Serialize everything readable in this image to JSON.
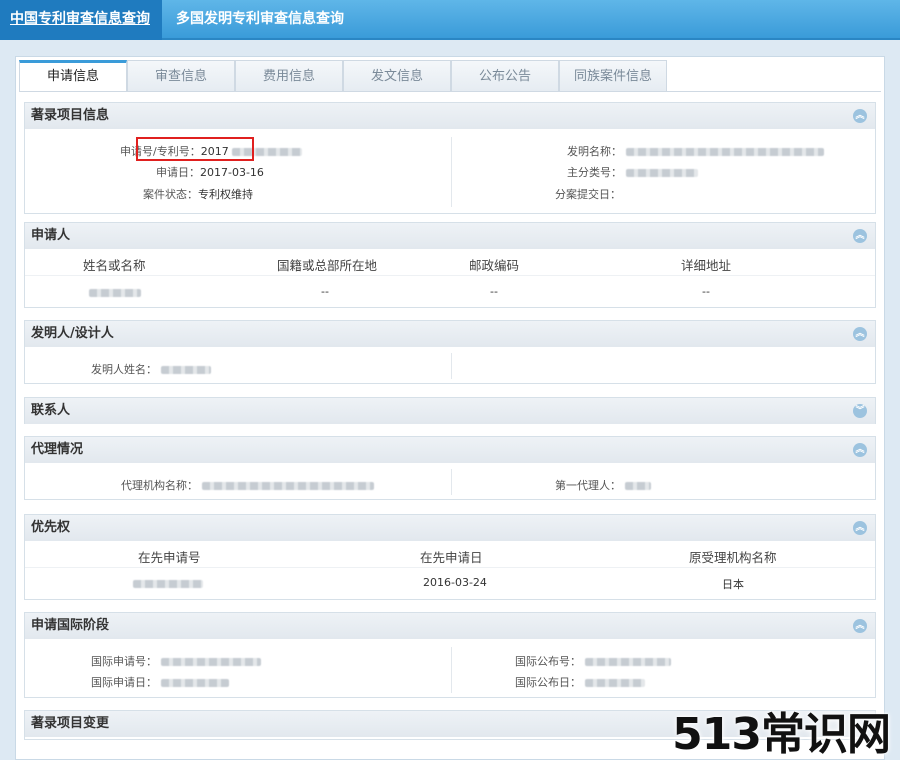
{
  "topnav": {
    "tabs": [
      "中国专利审查信息查询",
      "多国发明专利审查信息查询"
    ]
  },
  "tabs": [
    "申请信息",
    "审查信息",
    "费用信息",
    "发文信息",
    "公布公告",
    "同族案件信息"
  ],
  "bibliographic": {
    "title": "著录项目信息",
    "app_no_label": "申请号/专利号：",
    "app_no_value": "2017",
    "app_date_label": "申请日：",
    "app_date_value": "2017-03-16",
    "status_label": "案件状态：",
    "status_value": "专利权维持",
    "invention_name_label": "发明名称：",
    "main_class_label": "主分类号：",
    "divisional_date_label": "分案提交日："
  },
  "applicant": {
    "title": "申请人",
    "headers": [
      "姓名或名称",
      "国籍或总部所在地",
      "邮政编码",
      "详细地址"
    ],
    "row": [
      "",
      "--",
      "--",
      "--"
    ]
  },
  "inventor": {
    "title": "发明人/设计人",
    "name_label": "发明人姓名："
  },
  "contact": {
    "title": "联系人"
  },
  "agency": {
    "title": "代理情况",
    "agency_label": "代理机构名称：",
    "first_agent_label": "第一代理人："
  },
  "priority": {
    "title": "优先权",
    "headers": [
      "在先申请号",
      "在先申请日",
      "原受理机构名称"
    ],
    "row": [
      "",
      "2016-03-24",
      "日本"
    ]
  },
  "pct": {
    "title": "申请国际阶段",
    "intl_app_no_label": "国际申请号：",
    "intl_app_date_label": "国际申请日：",
    "intl_pub_no_label": "国际公布号：",
    "intl_pub_date_label": "国际公布日："
  },
  "changes": {
    "title": "著录项目变更"
  },
  "watermark": "513常识网",
  "icons": {
    "section_toggle": "chevron-up-circle-icon"
  },
  "colors": {
    "accent": "#3a9bd9",
    "highlight": "#e0201f"
  }
}
